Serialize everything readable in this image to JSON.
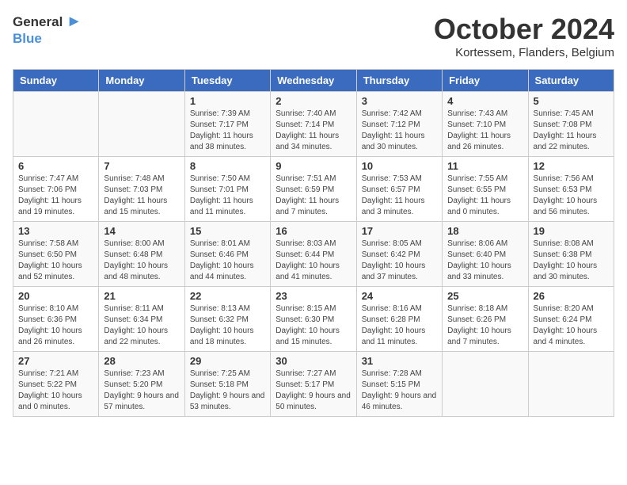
{
  "header": {
    "logo_general": "General",
    "logo_blue": "Blue",
    "month": "October 2024",
    "location": "Kortessem, Flanders, Belgium"
  },
  "days_of_week": [
    "Sunday",
    "Monday",
    "Tuesday",
    "Wednesday",
    "Thursday",
    "Friday",
    "Saturday"
  ],
  "weeks": [
    [
      {
        "day": "",
        "sunrise": "",
        "sunset": "",
        "daylight": ""
      },
      {
        "day": "",
        "sunrise": "",
        "sunset": "",
        "daylight": ""
      },
      {
        "day": "1",
        "sunrise": "Sunrise: 7:39 AM",
        "sunset": "Sunset: 7:17 PM",
        "daylight": "Daylight: 11 hours and 38 minutes."
      },
      {
        "day": "2",
        "sunrise": "Sunrise: 7:40 AM",
        "sunset": "Sunset: 7:14 PM",
        "daylight": "Daylight: 11 hours and 34 minutes."
      },
      {
        "day": "3",
        "sunrise": "Sunrise: 7:42 AM",
        "sunset": "Sunset: 7:12 PM",
        "daylight": "Daylight: 11 hours and 30 minutes."
      },
      {
        "day": "4",
        "sunrise": "Sunrise: 7:43 AM",
        "sunset": "Sunset: 7:10 PM",
        "daylight": "Daylight: 11 hours and 26 minutes."
      },
      {
        "day": "5",
        "sunrise": "Sunrise: 7:45 AM",
        "sunset": "Sunset: 7:08 PM",
        "daylight": "Daylight: 11 hours and 22 minutes."
      }
    ],
    [
      {
        "day": "6",
        "sunrise": "Sunrise: 7:47 AM",
        "sunset": "Sunset: 7:06 PM",
        "daylight": "Daylight: 11 hours and 19 minutes."
      },
      {
        "day": "7",
        "sunrise": "Sunrise: 7:48 AM",
        "sunset": "Sunset: 7:03 PM",
        "daylight": "Daylight: 11 hours and 15 minutes."
      },
      {
        "day": "8",
        "sunrise": "Sunrise: 7:50 AM",
        "sunset": "Sunset: 7:01 PM",
        "daylight": "Daylight: 11 hours and 11 minutes."
      },
      {
        "day": "9",
        "sunrise": "Sunrise: 7:51 AM",
        "sunset": "Sunset: 6:59 PM",
        "daylight": "Daylight: 11 hours and 7 minutes."
      },
      {
        "day": "10",
        "sunrise": "Sunrise: 7:53 AM",
        "sunset": "Sunset: 6:57 PM",
        "daylight": "Daylight: 11 hours and 3 minutes."
      },
      {
        "day": "11",
        "sunrise": "Sunrise: 7:55 AM",
        "sunset": "Sunset: 6:55 PM",
        "daylight": "Daylight: 11 hours and 0 minutes."
      },
      {
        "day": "12",
        "sunrise": "Sunrise: 7:56 AM",
        "sunset": "Sunset: 6:53 PM",
        "daylight": "Daylight: 10 hours and 56 minutes."
      }
    ],
    [
      {
        "day": "13",
        "sunrise": "Sunrise: 7:58 AM",
        "sunset": "Sunset: 6:50 PM",
        "daylight": "Daylight: 10 hours and 52 minutes."
      },
      {
        "day": "14",
        "sunrise": "Sunrise: 8:00 AM",
        "sunset": "Sunset: 6:48 PM",
        "daylight": "Daylight: 10 hours and 48 minutes."
      },
      {
        "day": "15",
        "sunrise": "Sunrise: 8:01 AM",
        "sunset": "Sunset: 6:46 PM",
        "daylight": "Daylight: 10 hours and 44 minutes."
      },
      {
        "day": "16",
        "sunrise": "Sunrise: 8:03 AM",
        "sunset": "Sunset: 6:44 PM",
        "daylight": "Daylight: 10 hours and 41 minutes."
      },
      {
        "day": "17",
        "sunrise": "Sunrise: 8:05 AM",
        "sunset": "Sunset: 6:42 PM",
        "daylight": "Daylight: 10 hours and 37 minutes."
      },
      {
        "day": "18",
        "sunrise": "Sunrise: 8:06 AM",
        "sunset": "Sunset: 6:40 PM",
        "daylight": "Daylight: 10 hours and 33 minutes."
      },
      {
        "day": "19",
        "sunrise": "Sunrise: 8:08 AM",
        "sunset": "Sunset: 6:38 PM",
        "daylight": "Daylight: 10 hours and 30 minutes."
      }
    ],
    [
      {
        "day": "20",
        "sunrise": "Sunrise: 8:10 AM",
        "sunset": "Sunset: 6:36 PM",
        "daylight": "Daylight: 10 hours and 26 minutes."
      },
      {
        "day": "21",
        "sunrise": "Sunrise: 8:11 AM",
        "sunset": "Sunset: 6:34 PM",
        "daylight": "Daylight: 10 hours and 22 minutes."
      },
      {
        "day": "22",
        "sunrise": "Sunrise: 8:13 AM",
        "sunset": "Sunset: 6:32 PM",
        "daylight": "Daylight: 10 hours and 18 minutes."
      },
      {
        "day": "23",
        "sunrise": "Sunrise: 8:15 AM",
        "sunset": "Sunset: 6:30 PM",
        "daylight": "Daylight: 10 hours and 15 minutes."
      },
      {
        "day": "24",
        "sunrise": "Sunrise: 8:16 AM",
        "sunset": "Sunset: 6:28 PM",
        "daylight": "Daylight: 10 hours and 11 minutes."
      },
      {
        "day": "25",
        "sunrise": "Sunrise: 8:18 AM",
        "sunset": "Sunset: 6:26 PM",
        "daylight": "Daylight: 10 hours and 7 minutes."
      },
      {
        "day": "26",
        "sunrise": "Sunrise: 8:20 AM",
        "sunset": "Sunset: 6:24 PM",
        "daylight": "Daylight: 10 hours and 4 minutes."
      }
    ],
    [
      {
        "day": "27",
        "sunrise": "Sunrise: 7:21 AM",
        "sunset": "Sunset: 5:22 PM",
        "daylight": "Daylight: 10 hours and 0 minutes."
      },
      {
        "day": "28",
        "sunrise": "Sunrise: 7:23 AM",
        "sunset": "Sunset: 5:20 PM",
        "daylight": "Daylight: 9 hours and 57 minutes."
      },
      {
        "day": "29",
        "sunrise": "Sunrise: 7:25 AM",
        "sunset": "Sunset: 5:18 PM",
        "daylight": "Daylight: 9 hours and 53 minutes."
      },
      {
        "day": "30",
        "sunrise": "Sunrise: 7:27 AM",
        "sunset": "Sunset: 5:17 PM",
        "daylight": "Daylight: 9 hours and 50 minutes."
      },
      {
        "day": "31",
        "sunrise": "Sunrise: 7:28 AM",
        "sunset": "Sunset: 5:15 PM",
        "daylight": "Daylight: 9 hours and 46 minutes."
      },
      {
        "day": "",
        "sunrise": "",
        "sunset": "",
        "daylight": ""
      },
      {
        "day": "",
        "sunrise": "",
        "sunset": "",
        "daylight": ""
      }
    ]
  ]
}
